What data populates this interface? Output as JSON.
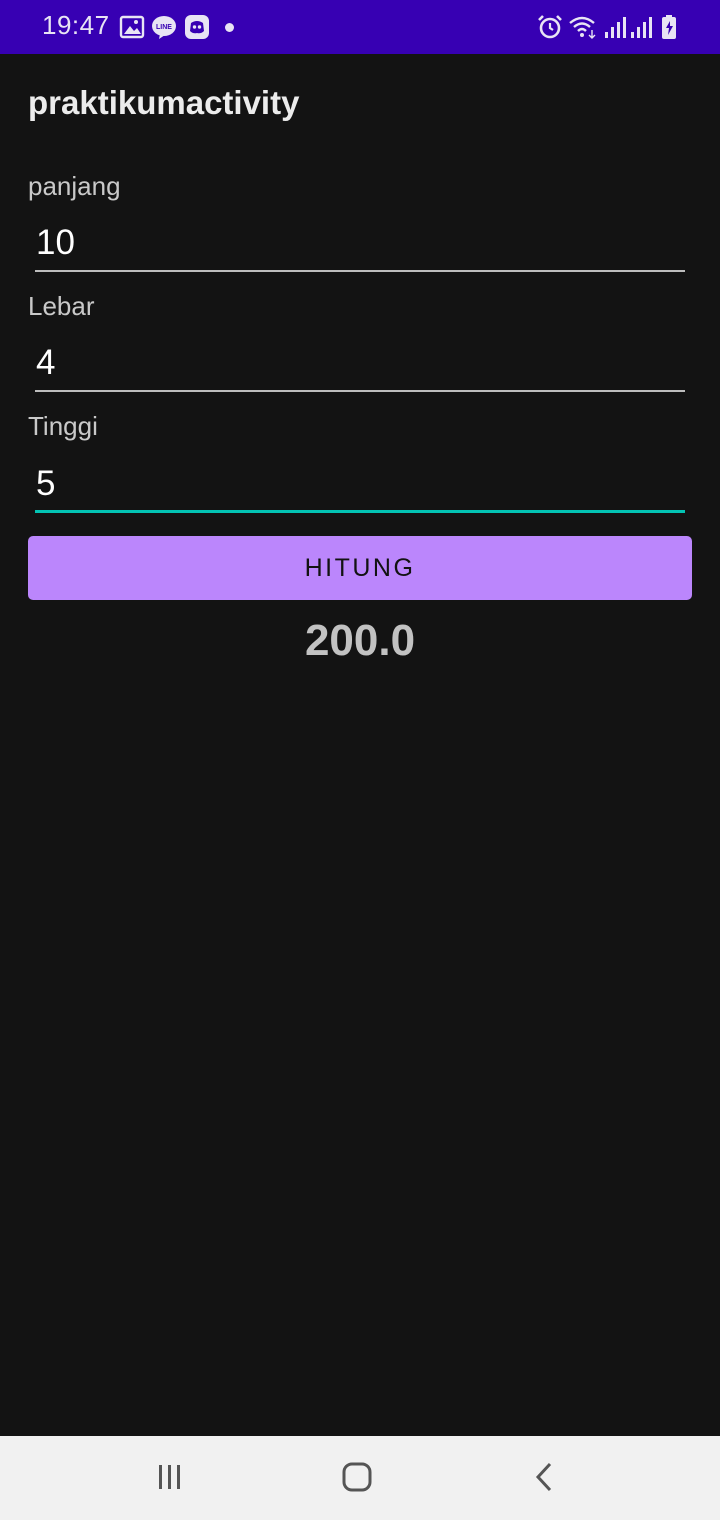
{
  "status_bar": {
    "time": "19:47",
    "left_icons": [
      "gallery-icon",
      "line-icon",
      "discord-icon",
      "notification-dot"
    ],
    "right_icons": [
      "alarm-icon",
      "wifi-icon",
      "signal-icon",
      "signal-icon-2",
      "battery-charging-icon"
    ],
    "background_color": "#3700b3"
  },
  "app": {
    "title": "praktikumactivity"
  },
  "fields": {
    "panjang": {
      "label": "panjang",
      "value": "10"
    },
    "lebar": {
      "label": "Lebar",
      "value": "4"
    },
    "tinggi": {
      "label": "Tinggi",
      "value": "5"
    }
  },
  "button": {
    "label": "HITUNG",
    "color": "#bb86fc"
  },
  "result": {
    "value": "200.0"
  },
  "nav_bar": {
    "buttons": [
      "recent-apps-icon",
      "home-icon",
      "back-icon"
    ]
  },
  "colors": {
    "background": "#131313",
    "focus_accent": "#03c4b4"
  }
}
